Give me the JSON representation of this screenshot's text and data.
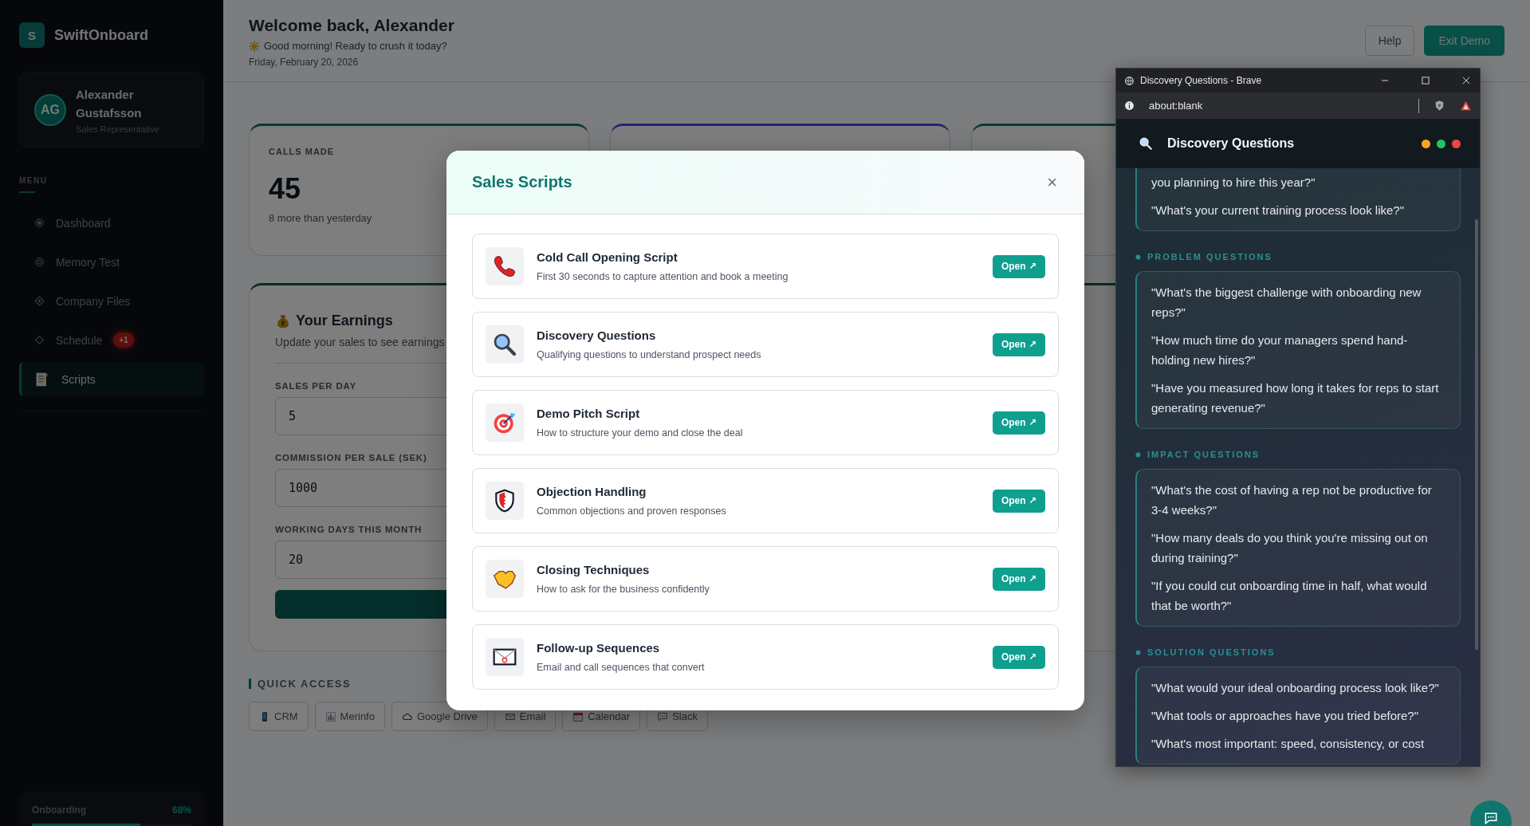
{
  "sidebar": {
    "logo_mark": "S",
    "brand": "SwiftOnboard",
    "profile": {
      "initials": "AG",
      "name": "Alexander Gustafsson",
      "role": "Sales Representative"
    },
    "menu_label": "MENU",
    "items": [
      {
        "label": "Dashboard",
        "selected": false
      },
      {
        "label": "Memory Test",
        "selected": false
      },
      {
        "label": "Company Files",
        "selected": false
      },
      {
        "label": "Schedule",
        "badge": "+1",
        "selected": false
      },
      {
        "label": "Scripts",
        "selected": true
      }
    ],
    "progress": {
      "label": "Onboarding",
      "reading": "68%",
      "level": 0.68
    }
  },
  "header": {
    "title": "Welcome back, Alexander",
    "greeting": "Good morning! Ready to crush it today?",
    "date": "Friday, February 20, 2026",
    "buttons": [
      {
        "label": "Help",
        "kind": "secondary"
      },
      {
        "label": "Exit Demo",
        "kind": "primary"
      }
    ]
  },
  "stats": [
    {
      "label": "CALLS MADE",
      "value": "45",
      "note": "8 more than yesterday"
    }
  ],
  "earnings": {
    "title": "Your Earnings",
    "subtitle": "Update your sales to see earnings",
    "fields": [
      {
        "label": "SALES PER DAY",
        "value": "5"
      },
      {
        "label": "COMMISSION PER SALE (SEK)",
        "value": "1000"
      },
      {
        "label": "WORKING DAYS THIS MONTH",
        "value": "20"
      }
    ]
  },
  "quick_access": {
    "title": "QUICK ACCESS",
    "links": [
      {
        "label": "CRM"
      },
      {
        "label": "Merinfo"
      },
      {
        "label": "Google Drive"
      },
      {
        "label": "Email"
      },
      {
        "label": "Calendar"
      },
      {
        "label": "Slack"
      }
    ]
  },
  "modal": {
    "title": "Sales Scripts",
    "close": "×",
    "scripts": [
      {
        "title": "Cold Call Opening Script",
        "description": "First 30 seconds to capture attention and book a meeting",
        "action": "Open ↗"
      },
      {
        "title": "Discovery Questions",
        "description": "Qualifying questions to understand prospect needs",
        "action": "Open ↗"
      },
      {
        "title": "Demo Pitch Script",
        "description": "How to structure your demo and close the deal",
        "action": "Open ↗"
      },
      {
        "title": "Objection Handling",
        "description": "Common objections and proven responses",
        "action": "Open ↗"
      },
      {
        "title": "Closing Techniques",
        "description": "How to ask for the business confidently",
        "action": "Open ↗"
      },
      {
        "title": "Follow-up Sequences",
        "description": "Email and call sequences that convert",
        "action": "Open ↗"
      }
    ]
  },
  "browser": {
    "title": "Discovery Questions - Brave",
    "address": "about:blank",
    "heading": "Discovery Questions",
    "dots": [
      {
        "color": "#f5a623"
      },
      {
        "color": "#22c55e"
      },
      {
        "color": "#ef4444"
      }
    ],
    "sections": [
      {
        "questions": [
          "you planning to hire this year?\"",
          "\"What's your current training process look like?\""
        ]
      },
      {
        "heading": "PROBLEM QUESTIONS",
        "questions": [
          "\"What's the biggest challenge with onboarding new reps?\"",
          "\"How much time do your managers spend hand-holding new hires?\"",
          "\"Have you measured how long it takes for reps to start generating revenue?\""
        ]
      },
      {
        "heading": "IMPACT QUESTIONS",
        "questions": [
          "\"What's the cost of having a rep not be productive for 3-4 weeks?\"",
          "\"How many deals do you think you're missing out on during training?\"",
          "\"If you could cut onboarding time in half, what would that be worth?\""
        ]
      },
      {
        "heading": "SOLUTION QUESTIONS",
        "questions": [
          "\"What would your ideal onboarding process look like?\"",
          "\"What tools or approaches have you tried before?\"",
          "\"What's most important: speed, consistency, or cost"
        ]
      }
    ]
  }
}
